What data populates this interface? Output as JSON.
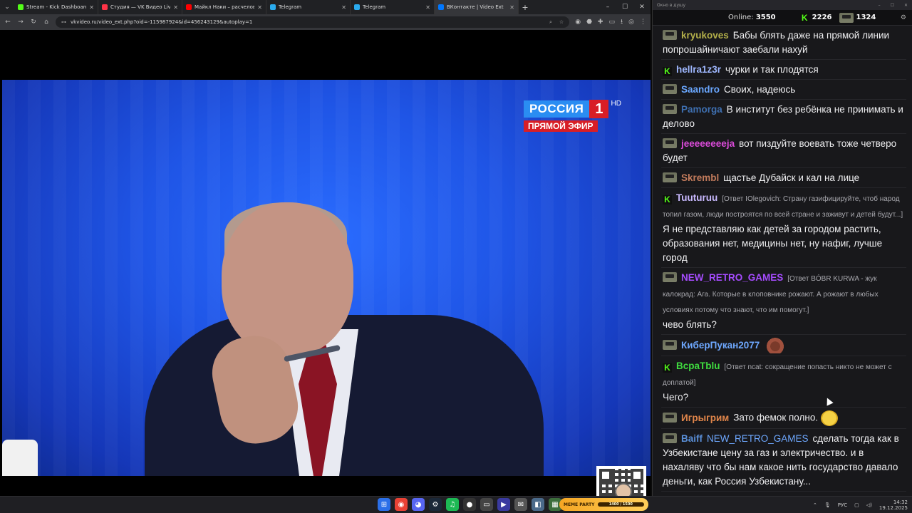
{
  "browser": {
    "tabs": [
      {
        "title": "Stream - Kick Dashboard",
        "color": "#53fc18",
        "active": false
      },
      {
        "title": "Студия — VK Видео Live",
        "color": "#ff3347",
        "active": false
      },
      {
        "title": "Майкл Наки – расчеловечива...",
        "color": "#ff0000",
        "active": false
      },
      {
        "title": "Telegram",
        "color": "#2aabee",
        "active": false
      },
      {
        "title": "Telegram",
        "color": "#2aabee",
        "active": false
      },
      {
        "title": "ВКонтакте | Video Ext",
        "color": "#0077ff",
        "active": true
      }
    ],
    "url": "vkvideo.ru/video_ext.php?oid=-115987924&id=456243129&autoplay=1"
  },
  "video": {
    "channel": "РОССИЯ",
    "channel_number": "1",
    "hd": "HD",
    "live_label": "ПРЯМОЙ ЭФИР"
  },
  "chat": {
    "window_title": "Окно в душу",
    "online_label": "Online:",
    "online_count": "3550",
    "kick_count": "2226",
    "twitch_count": "1324",
    "messages": [
      {
        "badge": "avatar",
        "user": "kryukoves",
        "color": "#b4b04a",
        "reply": "",
        "text": "Бабы блять даже на прямой линии попрошайничают заебали нахуй"
      },
      {
        "badge": "kick",
        "user": "hellra1z3r",
        "color": "#9fb8ff",
        "reply": "",
        "text": "чурки и так плодятся"
      },
      {
        "badge": "avatar",
        "user": "Saandro",
        "color": "#6aa7ff",
        "reply": "",
        "text": "Своих, надеюсь"
      },
      {
        "badge": "avatar",
        "user": "Pamorga",
        "color": "#3e6fb0",
        "reply": "",
        "text": "В институт без ребёнка не принимать и делово"
      },
      {
        "badge": "avatar",
        "user": "jeeeeeeeeja",
        "color": "#d94bd8",
        "reply": "",
        "text": "вот пиздуйте воевать тоже четверо будет"
      },
      {
        "badge": "avatar",
        "user": "Skrembl",
        "color": "#c27b5c",
        "reply": "",
        "text": "щастье Дубайск и кал на лице"
      },
      {
        "badge": "kick",
        "user": "Tuuturuu",
        "color": "#c9b9ff",
        "reply": "[Ответ IOlegovich: Страну газифицируйте, чтоб народ топил газом, люди построятся по всей стране и заживут и детей будут...]",
        "text": "Я не представляю как детей за городом растить, образования нет, медицины нет, ну нафиг, лучше город"
      },
      {
        "badge": "avatar",
        "user": "NEW_RETRO_GAMES",
        "color": "#a64cff",
        "reply": "[Ответ BÓBR KURWA - жук калокрад: Ага. Которые в клоповнике рожают. А рожают в любых условиях потому что знают, что им помогут.]",
        "text": "чево блять?"
      },
      {
        "badge": "avatar",
        "user": "КиберПукан2077",
        "color": "#6ea8ff",
        "reply": "",
        "text": "",
        "emote": "monster"
      },
      {
        "badge": "kick",
        "user": "BcpaTblu",
        "color": "#3fdc3f",
        "reply": "[Ответ ncat: сокращение попасть никто не может с доплатой]",
        "text": "Чего?"
      },
      {
        "badge": "avatar",
        "user": "Игрыгрим",
        "color": "#e0854a",
        "reply": "",
        "text": "Зато фемок полно.",
        "emote": "smile"
      },
      {
        "badge": "avatar",
        "user": "Baiff",
        "color": "#5a8fd8",
        "mention": "NEW_RETRO_GAMES",
        "reply": "",
        "text": "сделать тогда как в Узбекистане цену за газ и электричество. и в нахаляву что бы нам какое нить государство давало деньги, как Россия Узбекистану..."
      }
    ]
  },
  "taskbar": {
    "widget_title": "MEME PARTY",
    "widget_progress": "1400 / 1500",
    "lang": "РУС",
    "time": "14:32",
    "date": "19.12.2025"
  }
}
